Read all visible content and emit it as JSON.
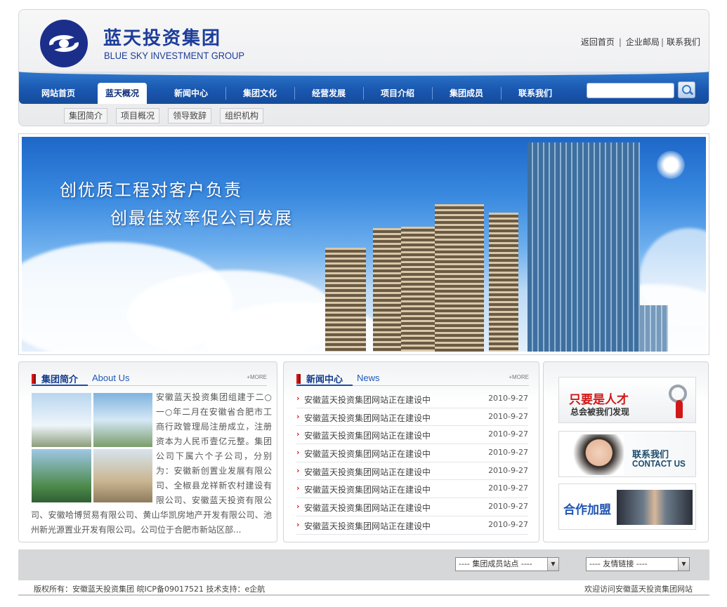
{
  "header": {
    "logo_cn": "蓝天投资集团",
    "logo_en": "BLUE SKY INVESTMENT GROUP",
    "top_links": [
      "返回首页",
      "企业邮局",
      "联系我们"
    ],
    "brand_color": "#1c3d9a"
  },
  "nav": {
    "items": [
      "网站首页",
      "蓝天概况",
      "新闻中心",
      "集团文化",
      "经营发展",
      "项目介绍",
      "集团成员",
      "联系我们"
    ],
    "active": "蓝天概况",
    "search_placeholder": ""
  },
  "subnav": {
    "items": [
      "集团简介",
      "项目概况",
      "领导致辞",
      "组织机构"
    ]
  },
  "banner": {
    "slogan1": "创优质工程对客户负责",
    "slogan2": "创最佳效率促公司发展"
  },
  "about": {
    "title_cn": "集团简介",
    "title_en": "About Us",
    "more": "+MORE",
    "text": "安徽蓝天投资集团组建于二○一○年二月在安徽省合肥市工商行政管理局注册成立，注册资本为人民币壹亿元整。集团公司下属六个子公司，分别为：安徽新创置业发展有限公司、全椒县龙祥新农村建设有限公司、安徽蓝天投资有限公司、安徽哈博贸易有限公司、黄山华凯房地产开发有限公司、池州新光源置业开发有限公司。公司位于合肥市新站区部..."
  },
  "news": {
    "title_cn": "新闻中心",
    "title_en": "News",
    "more": "+MORE",
    "items": [
      {
        "title": "安徽蓝天投资集团网站正在建设中",
        "date": "2010-9-27"
      },
      {
        "title": "安徽蓝天投资集团网站正在建设中",
        "date": "2010-9-27"
      },
      {
        "title": "安徽蓝天投资集团网站正在建设中",
        "date": "2010-9-27"
      },
      {
        "title": "安徽蓝天投资集团网站正在建设中",
        "date": "2010-9-27"
      },
      {
        "title": "安徽蓝天投资集团网站正在建设中",
        "date": "2010-9-27"
      },
      {
        "title": "安徽蓝天投资集团网站正在建设中",
        "date": "2010-9-27"
      },
      {
        "title": "安徽蓝天投资集团网站正在建设中",
        "date": "2010-9-27"
      },
      {
        "title": "安徽蓝天投资集团网站正在建设中",
        "date": "2010-9-27"
      }
    ]
  },
  "side": {
    "talent_line1": "只要是人才",
    "talent_line2": "总会被我们发现",
    "contact_cn": "联系我们",
    "contact_en": "CONTACT US",
    "join": "合作加盟"
  },
  "footer": {
    "select_members": "---- 集团成员站点 ----",
    "select_links": "---- 友情链接 ----",
    "copyright": "版权所有：安徽蓝天投资集团   皖ICP备09017521   技术支持：e企航",
    "welcome": "欢迎访问安徽蓝天投资集团网站"
  }
}
